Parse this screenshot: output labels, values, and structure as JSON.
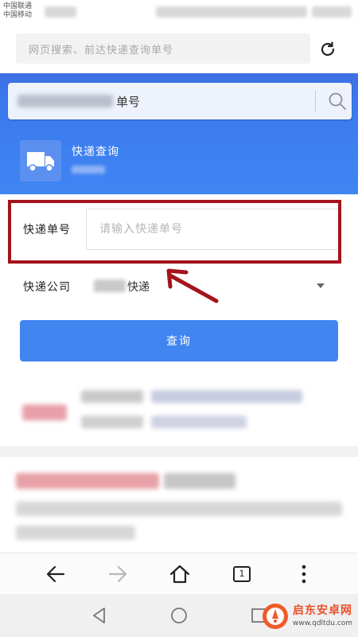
{
  "status_bar": {
    "carrier_line1": "中国联通",
    "carrier_line2": "中国移动"
  },
  "top_search": {
    "placeholder": "网页搜索、前达快递查询单号"
  },
  "card": {
    "search_suffix": "单号",
    "app_title": "快递查询",
    "icon": "truck-icon"
  },
  "form": {
    "number_label": "快递单号",
    "number_placeholder": "请输入快递单号",
    "company_label": "快递公司",
    "company_value": "快递",
    "query_label": "查询"
  },
  "browser_toolbar": {
    "tab_count": "1"
  },
  "watermark": {
    "name": "启东安卓网",
    "url": "www.qdltdu.com"
  },
  "colors": {
    "accent_blue": "#4185f0",
    "annotation_red": "#a3141c"
  }
}
